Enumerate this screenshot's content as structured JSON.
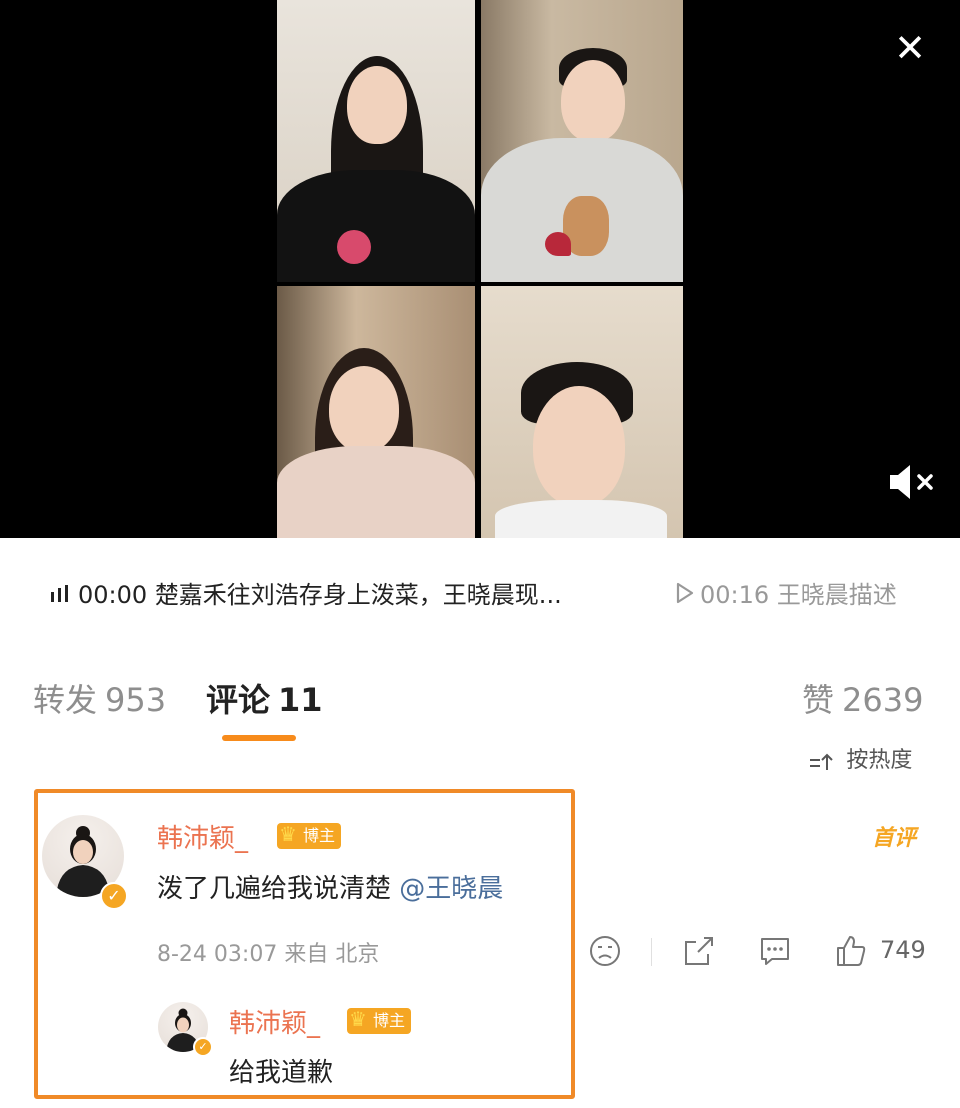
{
  "video": {
    "close_label": "✕"
  },
  "audio": {
    "current": {
      "icon": "audio-wave-icon",
      "time": "00:00",
      "text": "楚嘉禾往刘浩存身上泼菜，王晓晨现..."
    },
    "next": {
      "icon": "play-icon",
      "time": "00:16",
      "text": "王晓晨描述"
    }
  },
  "tabs": [
    {
      "label": "转发",
      "count": "953"
    },
    {
      "label": "评论",
      "count": "11"
    },
    {
      "label": "赞",
      "count": "2639"
    }
  ],
  "sort": {
    "icon": "sort-icon",
    "label": "按热度"
  },
  "comment": {
    "user": "韩沛颖_",
    "badge": "博主",
    "first_tag": "首评",
    "text": "泼了几遍给我说清楚",
    "mention": "@王晓晨",
    "time": "8-24 03:07",
    "location": "来自 北京",
    "like_count": "749",
    "reply": {
      "user": "韩沛颖_",
      "badge": "博主",
      "text": "给我道歉"
    }
  },
  "colors": {
    "accent": "#f78b1b",
    "username": "#eb7350",
    "badge": "#f5a623",
    "highlight_border": "#f08a28",
    "mention": "#4a6e9b"
  }
}
